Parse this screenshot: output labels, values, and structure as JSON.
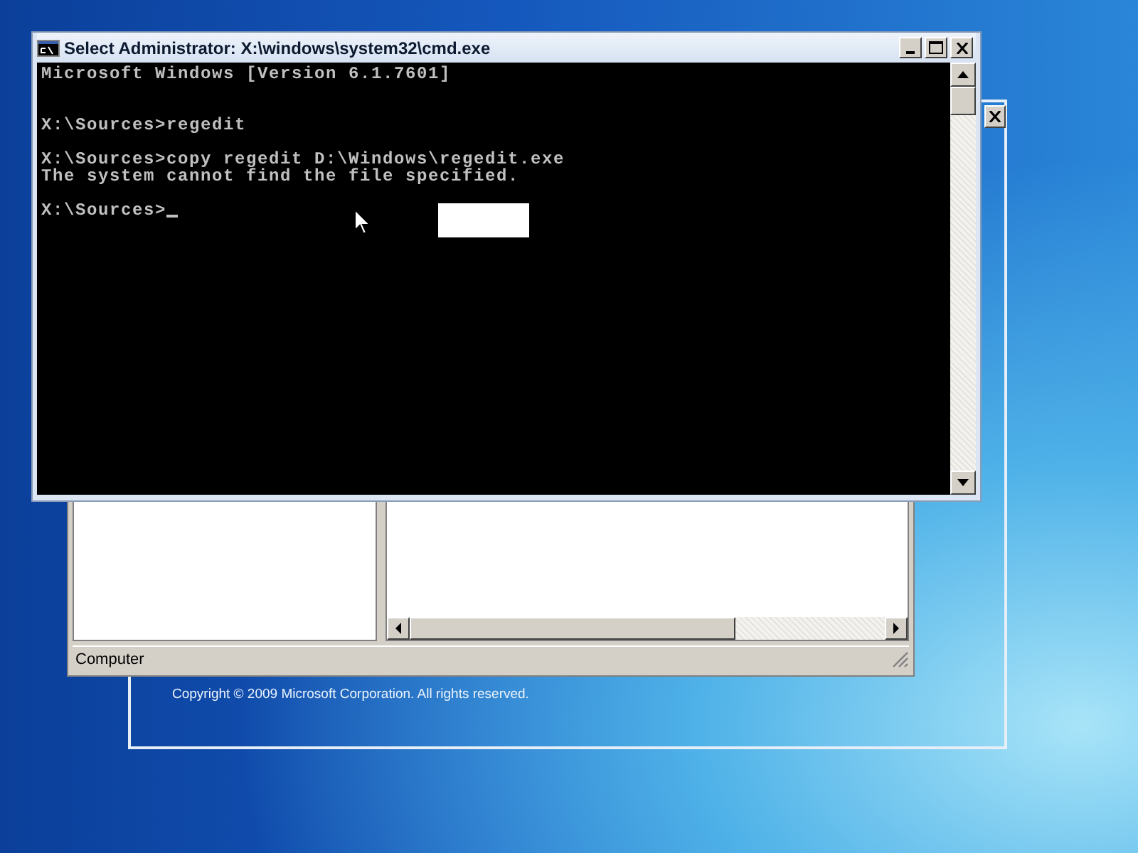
{
  "cmd_window": {
    "title": "Select Administrator: X:\\windows\\system32\\cmd.exe",
    "lines": [
      {
        "kind": "output",
        "text": "Microsoft Windows [Version 6.1.7601]"
      },
      {
        "kind": "blank"
      },
      {
        "kind": "blank"
      },
      {
        "kind": "output",
        "text": "X:\\Sources>regedit"
      },
      {
        "kind": "blank"
      },
      {
        "kind": "output",
        "text": "X:\\Sources>copy regedit D:\\Windows\\regedit.exe"
      },
      {
        "kind": "output",
        "text": "The system cannot find the file specified."
      },
      {
        "kind": "blank"
      }
    ],
    "prompt": "X:\\Sources>",
    "cursor": true
  },
  "registry_window": {
    "status_bar": "Computer"
  },
  "setup_window": {
    "copyright": "Copyright © 2009 Microsoft Corporation. All rights reserved."
  }
}
